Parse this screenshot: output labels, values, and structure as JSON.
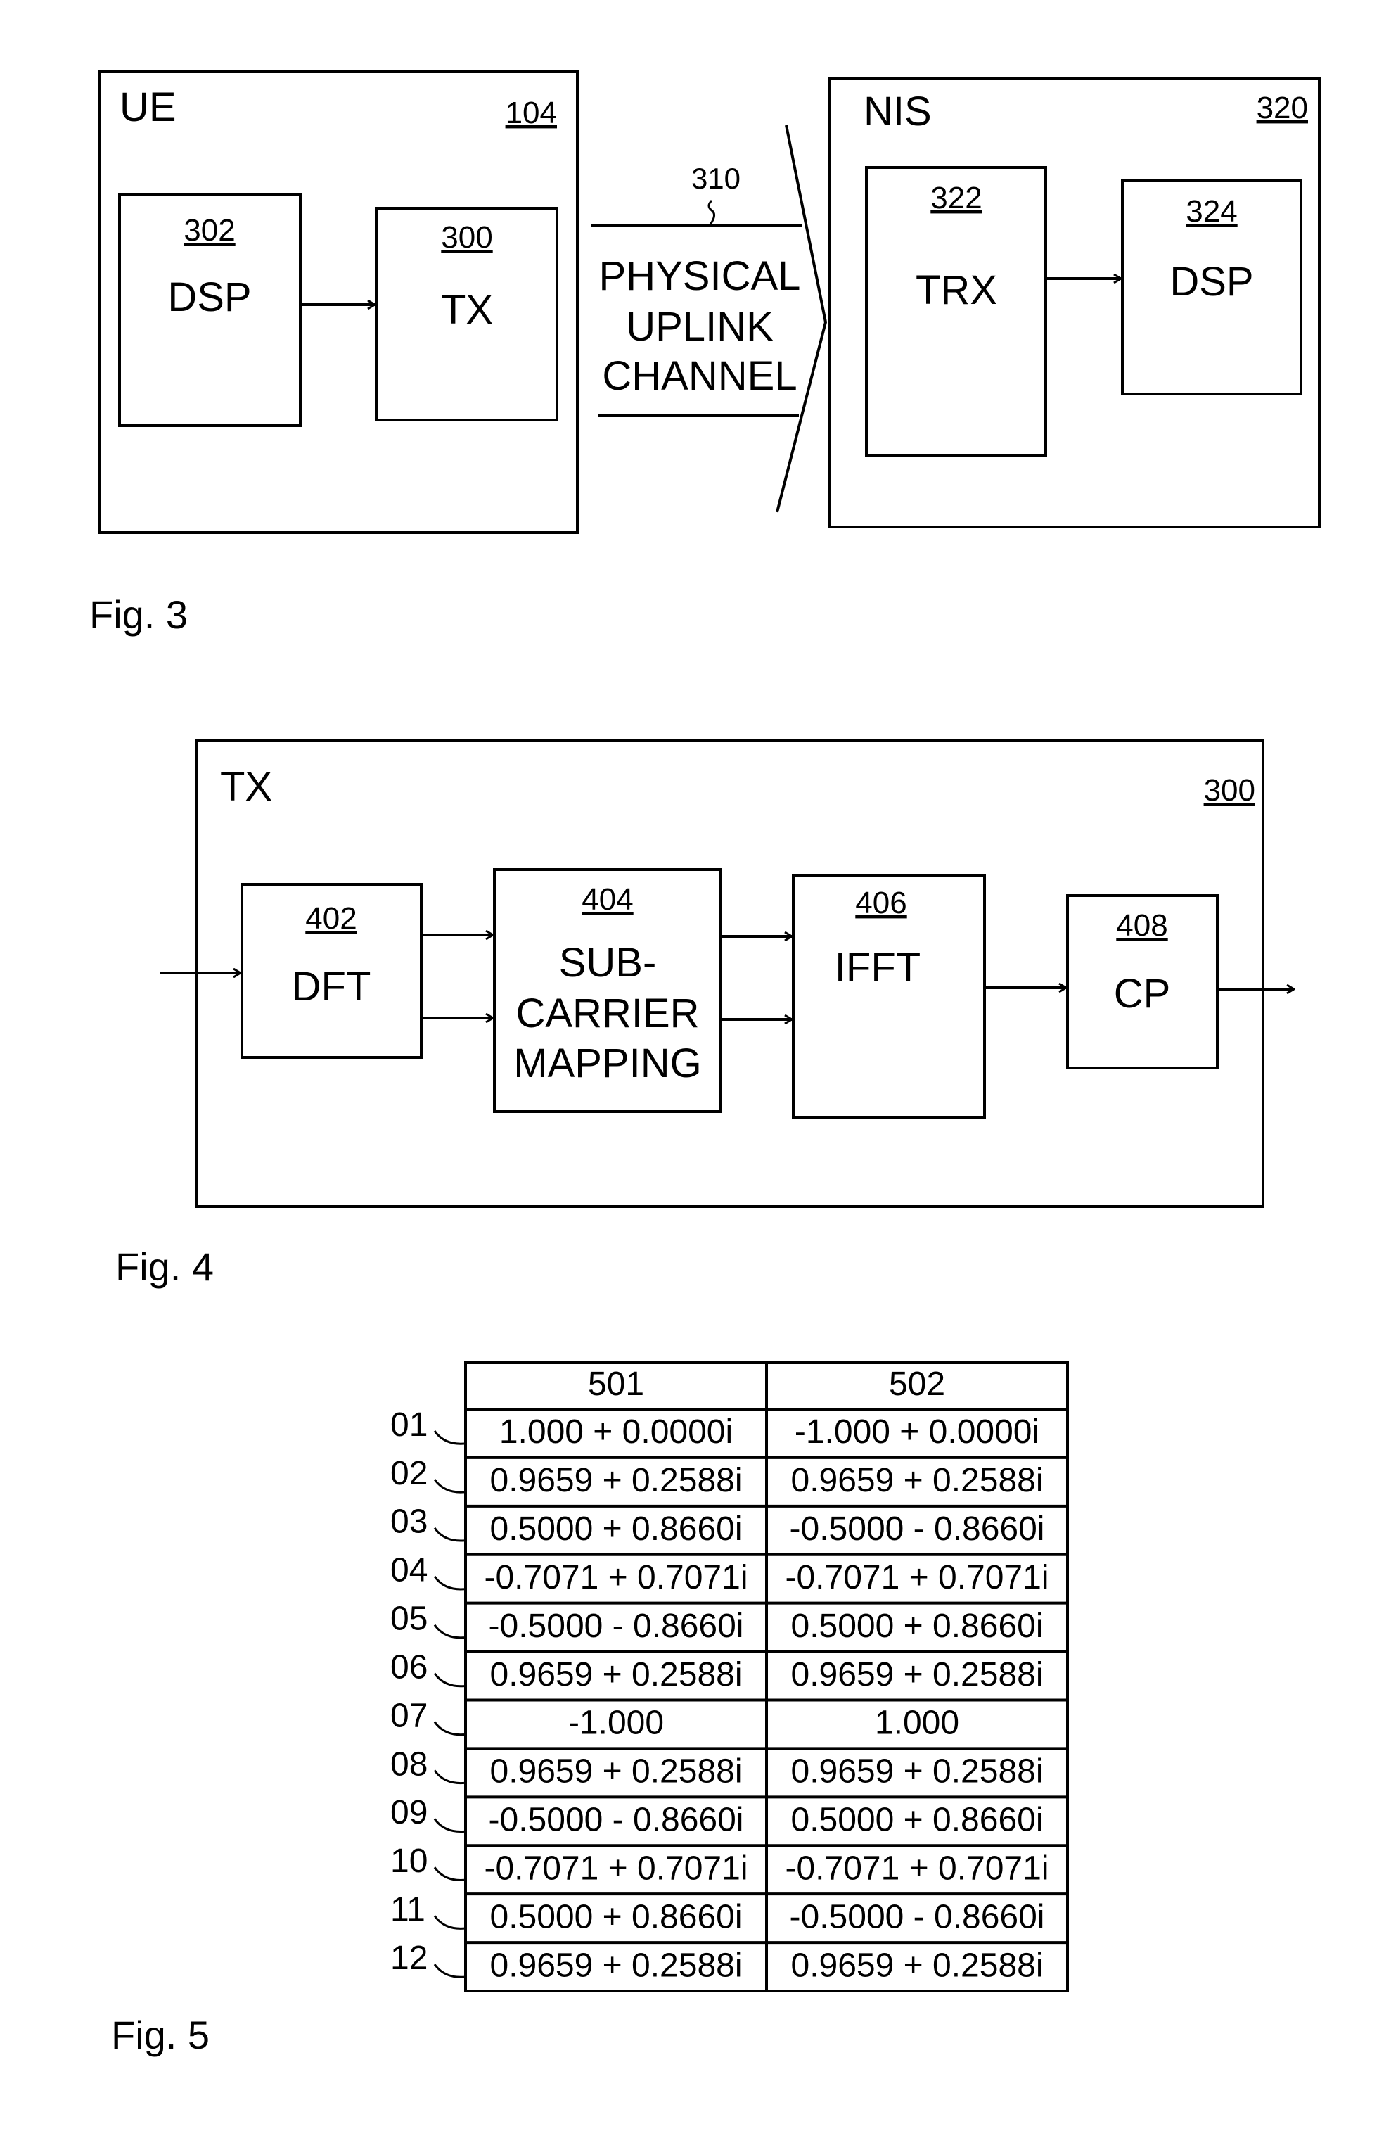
{
  "fig3": {
    "caption": "Fig. 3",
    "ue": {
      "title": "UE",
      "ref": "104"
    },
    "ue_dsp": {
      "ref": "302",
      "label": "DSP"
    },
    "ue_tx": {
      "ref": "300",
      "label": "TX"
    },
    "channel": {
      "ref": "310",
      "lines": [
        "PHYSICAL",
        "UPLINK",
        "CHANNEL"
      ]
    },
    "nis": {
      "title": "NIS",
      "ref": "320"
    },
    "nis_trx": {
      "ref": "322",
      "label": "TRX"
    },
    "nis_dsp": {
      "ref": "324",
      "label": "DSP"
    }
  },
  "fig4": {
    "caption": "Fig. 4",
    "tx": {
      "title": "TX",
      "ref": "300"
    },
    "blocks": [
      {
        "ref": "402",
        "lines": [
          "DFT"
        ]
      },
      {
        "ref": "404",
        "lines": [
          "SUB-",
          "CARRIER",
          "MAPPING"
        ]
      },
      {
        "ref": "406",
        "lines": [
          "IFFT"
        ]
      },
      {
        "ref": "408",
        "lines": [
          "CP"
        ]
      }
    ]
  },
  "fig5": {
    "caption": "Fig. 5",
    "columns": [
      "501",
      "502"
    ],
    "rows": [
      {
        "label": "01",
        "c501": "1.000 + 0.0000i",
        "c502": "-1.000 + 0.0000i"
      },
      {
        "label": "02",
        "c501": "0.9659 + 0.2588i",
        "c502": "0.9659 + 0.2588i"
      },
      {
        "label": "03",
        "c501": "0.5000 + 0.8660i",
        "c502": "-0.5000 - 0.8660i"
      },
      {
        "label": "04",
        "c501": "-0.7071 + 0.7071i",
        "c502": "-0.7071 + 0.7071i"
      },
      {
        "label": "05",
        "c501": "-0.5000 - 0.8660i",
        "c502": "0.5000 + 0.8660i"
      },
      {
        "label": "06",
        "c501": "0.9659 + 0.2588i",
        "c502": "0.9659 + 0.2588i"
      },
      {
        "label": "07",
        "c501": "-1.000",
        "c502": "1.000"
      },
      {
        "label": "08",
        "c501": "0.9659 + 0.2588i",
        "c502": "0.9659 + 0.2588i"
      },
      {
        "label": "09",
        "c501": "-0.5000 - 0.8660i",
        "c502": "0.5000 + 0.8660i"
      },
      {
        "label": "10",
        "c501": "-0.7071 + 0.7071i",
        "c502": "-0.7071 + 0.7071i"
      },
      {
        "label": "11",
        "c501": "0.5000 + 0.8660i",
        "c502": "-0.5000 - 0.8660i"
      },
      {
        "label": "12",
        "c501": "0.9659 + 0.2588i",
        "c502": "0.9659 + 0.2588i"
      }
    ]
  }
}
